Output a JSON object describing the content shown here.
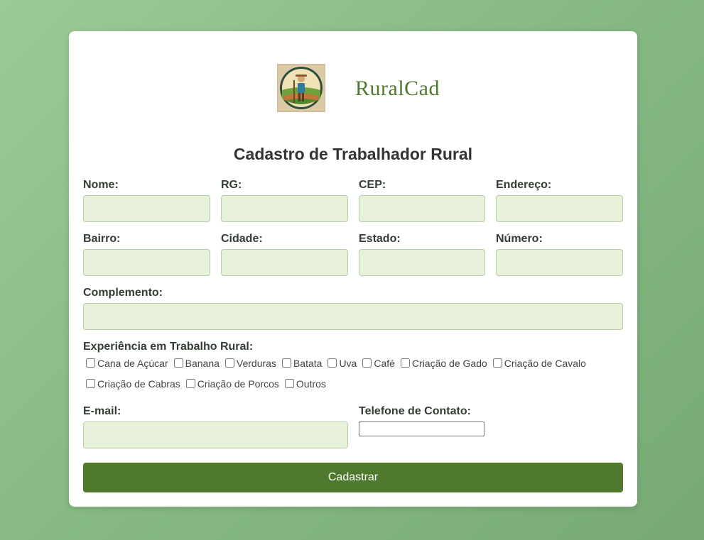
{
  "brand": {
    "name": "RuralCad"
  },
  "form": {
    "title": "Cadastro de Trabalhador Rural",
    "fields": {
      "nome": {
        "label": "Nome:",
        "value": ""
      },
      "rg": {
        "label": "RG:",
        "value": ""
      },
      "cep": {
        "label": "CEP:",
        "value": ""
      },
      "endereco": {
        "label": "Endereço:",
        "value": ""
      },
      "bairro": {
        "label": "Bairro:",
        "value": ""
      },
      "cidade": {
        "label": "Cidade:",
        "value": ""
      },
      "estado": {
        "label": "Estado:",
        "value": ""
      },
      "numero": {
        "label": "Número:",
        "value": ""
      },
      "complemento": {
        "label": "Complemento:",
        "value": ""
      },
      "email": {
        "label": "E-mail:",
        "value": ""
      },
      "telefone": {
        "label": "Telefone de Contato:",
        "value": ""
      }
    },
    "experience": {
      "label": "Experiência em Trabalho Rural:",
      "options": [
        {
          "label": "Cana de Açúcar",
          "checked": false
        },
        {
          "label": "Banana",
          "checked": false
        },
        {
          "label": "Verduras",
          "checked": false
        },
        {
          "label": "Batata",
          "checked": false
        },
        {
          "label": "Uva",
          "checked": false
        },
        {
          "label": "Café",
          "checked": false
        },
        {
          "label": "Criação de Gado",
          "checked": false
        },
        {
          "label": "Criação de Cavalo",
          "checked": false
        },
        {
          "label": "Criação de Cabras",
          "checked": false
        },
        {
          "label": "Criação de Porcos",
          "checked": false
        },
        {
          "label": "Outros",
          "checked": false
        }
      ]
    },
    "submit_label": "Cadastrar"
  },
  "colors": {
    "accent": "#4f7a2d",
    "input_bg": "#e8f1da",
    "background": "#8bbd87"
  }
}
